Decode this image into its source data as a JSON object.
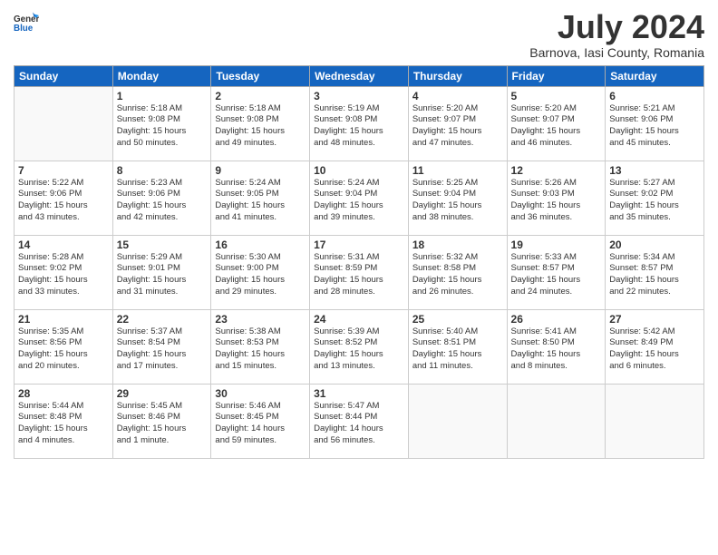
{
  "header": {
    "logo_general": "General",
    "logo_blue": "Blue",
    "month_year": "July 2024",
    "location": "Barnova, Iasi County, Romania"
  },
  "weekdays": [
    "Sunday",
    "Monday",
    "Tuesday",
    "Wednesday",
    "Thursday",
    "Friday",
    "Saturday"
  ],
  "weeks": [
    [
      {
        "day": "",
        "info": ""
      },
      {
        "day": "1",
        "info": "Sunrise: 5:18 AM\nSunset: 9:08 PM\nDaylight: 15 hours\nand 50 minutes."
      },
      {
        "day": "2",
        "info": "Sunrise: 5:18 AM\nSunset: 9:08 PM\nDaylight: 15 hours\nand 49 minutes."
      },
      {
        "day": "3",
        "info": "Sunrise: 5:19 AM\nSunset: 9:08 PM\nDaylight: 15 hours\nand 48 minutes."
      },
      {
        "day": "4",
        "info": "Sunrise: 5:20 AM\nSunset: 9:07 PM\nDaylight: 15 hours\nand 47 minutes."
      },
      {
        "day": "5",
        "info": "Sunrise: 5:20 AM\nSunset: 9:07 PM\nDaylight: 15 hours\nand 46 minutes."
      },
      {
        "day": "6",
        "info": "Sunrise: 5:21 AM\nSunset: 9:06 PM\nDaylight: 15 hours\nand 45 minutes."
      }
    ],
    [
      {
        "day": "7",
        "info": "Sunrise: 5:22 AM\nSunset: 9:06 PM\nDaylight: 15 hours\nand 43 minutes."
      },
      {
        "day": "8",
        "info": "Sunrise: 5:23 AM\nSunset: 9:06 PM\nDaylight: 15 hours\nand 42 minutes."
      },
      {
        "day": "9",
        "info": "Sunrise: 5:24 AM\nSunset: 9:05 PM\nDaylight: 15 hours\nand 41 minutes."
      },
      {
        "day": "10",
        "info": "Sunrise: 5:24 AM\nSunset: 9:04 PM\nDaylight: 15 hours\nand 39 minutes."
      },
      {
        "day": "11",
        "info": "Sunrise: 5:25 AM\nSunset: 9:04 PM\nDaylight: 15 hours\nand 38 minutes."
      },
      {
        "day": "12",
        "info": "Sunrise: 5:26 AM\nSunset: 9:03 PM\nDaylight: 15 hours\nand 36 minutes."
      },
      {
        "day": "13",
        "info": "Sunrise: 5:27 AM\nSunset: 9:02 PM\nDaylight: 15 hours\nand 35 minutes."
      }
    ],
    [
      {
        "day": "14",
        "info": "Sunrise: 5:28 AM\nSunset: 9:02 PM\nDaylight: 15 hours\nand 33 minutes."
      },
      {
        "day": "15",
        "info": "Sunrise: 5:29 AM\nSunset: 9:01 PM\nDaylight: 15 hours\nand 31 minutes."
      },
      {
        "day": "16",
        "info": "Sunrise: 5:30 AM\nSunset: 9:00 PM\nDaylight: 15 hours\nand 29 minutes."
      },
      {
        "day": "17",
        "info": "Sunrise: 5:31 AM\nSunset: 8:59 PM\nDaylight: 15 hours\nand 28 minutes."
      },
      {
        "day": "18",
        "info": "Sunrise: 5:32 AM\nSunset: 8:58 PM\nDaylight: 15 hours\nand 26 minutes."
      },
      {
        "day": "19",
        "info": "Sunrise: 5:33 AM\nSunset: 8:57 PM\nDaylight: 15 hours\nand 24 minutes."
      },
      {
        "day": "20",
        "info": "Sunrise: 5:34 AM\nSunset: 8:57 PM\nDaylight: 15 hours\nand 22 minutes."
      }
    ],
    [
      {
        "day": "21",
        "info": "Sunrise: 5:35 AM\nSunset: 8:56 PM\nDaylight: 15 hours\nand 20 minutes."
      },
      {
        "day": "22",
        "info": "Sunrise: 5:37 AM\nSunset: 8:54 PM\nDaylight: 15 hours\nand 17 minutes."
      },
      {
        "day": "23",
        "info": "Sunrise: 5:38 AM\nSunset: 8:53 PM\nDaylight: 15 hours\nand 15 minutes."
      },
      {
        "day": "24",
        "info": "Sunrise: 5:39 AM\nSunset: 8:52 PM\nDaylight: 15 hours\nand 13 minutes."
      },
      {
        "day": "25",
        "info": "Sunrise: 5:40 AM\nSunset: 8:51 PM\nDaylight: 15 hours\nand 11 minutes."
      },
      {
        "day": "26",
        "info": "Sunrise: 5:41 AM\nSunset: 8:50 PM\nDaylight: 15 hours\nand 8 minutes."
      },
      {
        "day": "27",
        "info": "Sunrise: 5:42 AM\nSunset: 8:49 PM\nDaylight: 15 hours\nand 6 minutes."
      }
    ],
    [
      {
        "day": "28",
        "info": "Sunrise: 5:44 AM\nSunset: 8:48 PM\nDaylight: 15 hours\nand 4 minutes."
      },
      {
        "day": "29",
        "info": "Sunrise: 5:45 AM\nSunset: 8:46 PM\nDaylight: 15 hours\nand 1 minute."
      },
      {
        "day": "30",
        "info": "Sunrise: 5:46 AM\nSunset: 8:45 PM\nDaylight: 14 hours\nand 59 minutes."
      },
      {
        "day": "31",
        "info": "Sunrise: 5:47 AM\nSunset: 8:44 PM\nDaylight: 14 hours\nand 56 minutes."
      },
      {
        "day": "",
        "info": ""
      },
      {
        "day": "",
        "info": ""
      },
      {
        "day": "",
        "info": ""
      }
    ]
  ]
}
